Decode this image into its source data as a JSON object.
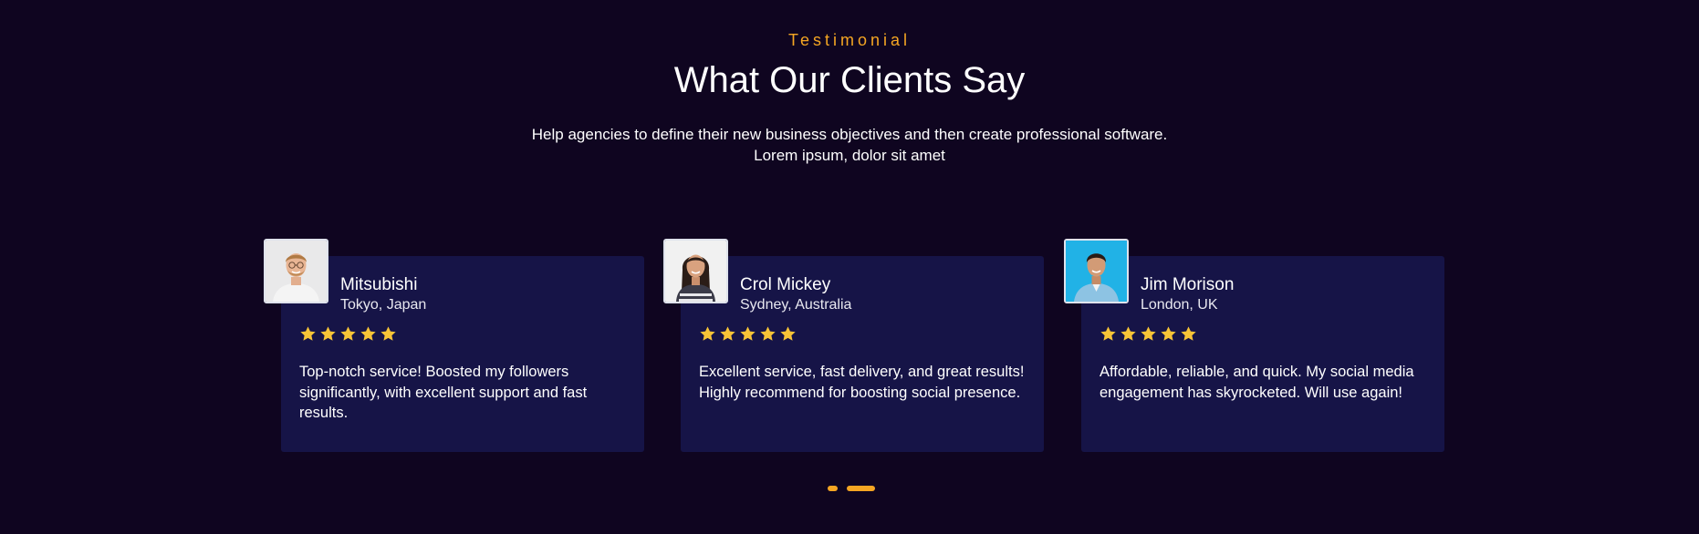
{
  "header": {
    "eyebrow": "Testimonial",
    "title": "What Our Clients Say",
    "subtitle": "Help agencies to define their new business objectives and then create professional software. Lorem ipsum, dolor sit amet"
  },
  "testimonials": [
    {
      "name": "Mitsubishi",
      "location": "Tokyo, Japan",
      "rating": 5,
      "quote": "Top-notch service! Boosted my followers significantly, with excellent support and fast results.",
      "avatar_icon": "avatar-man-glasses-photo"
    },
    {
      "name": "Crol Mickey",
      "location": "Sydney, Australia",
      "rating": 5,
      "quote": "Excellent service, fast delivery, and great results! Highly recommend for boosting social presence.",
      "avatar_icon": "avatar-woman-photo"
    },
    {
      "name": "Jim Morison",
      "location": "London, UK",
      "rating": 5,
      "quote": "Affordable, reliable, and quick. My social media engagement has skyrocketed. Will use again!",
      "avatar_icon": "avatar-man-blue-photo"
    }
  ],
  "pagination": {
    "page_count": 2,
    "active_page": 2
  },
  "colors": {
    "background": "#0f0520",
    "card": "#161447",
    "accent": "#f5a623",
    "star": "#f7c437"
  }
}
